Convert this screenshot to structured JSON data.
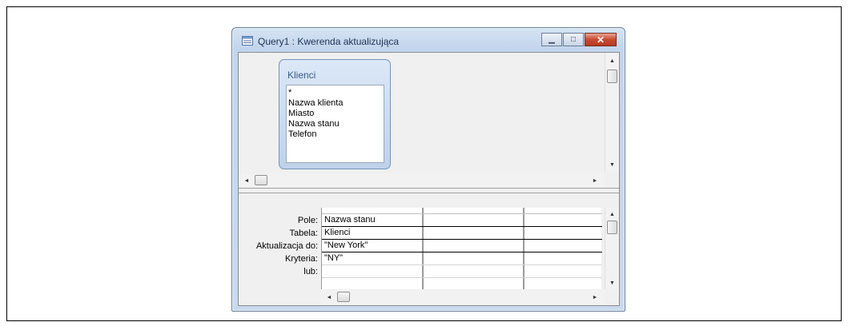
{
  "window": {
    "title": "Query1 : Kwerenda aktualizująca",
    "icon": "query-icon",
    "buttons": {
      "minimize": "▁",
      "maximize": "□",
      "close": "✕"
    }
  },
  "table": {
    "name": "Klienci",
    "fields": [
      "*",
      "Nazwa klienta",
      "Miasto",
      "Nazwa stanu",
      "Telefon"
    ]
  },
  "grid": {
    "row_labels": [
      "Pole:",
      "Tabela:",
      "Aktualizacja do:",
      "Kryteria:",
      "lub:"
    ],
    "columns": [
      {
        "pole": "Nazwa stanu",
        "tabela": "Klienci",
        "aktualizacja": "\"New York\"",
        "kryteria": "\"NY\"",
        "lub": ""
      },
      {
        "pole": "",
        "tabela": "",
        "aktualizacja": "",
        "kryteria": "",
        "lub": ""
      },
      {
        "pole": "",
        "tabela": "",
        "aktualizacja": "",
        "kryteria": "",
        "lub": ""
      }
    ]
  },
  "scroll_glyphs": {
    "up": "▲",
    "down": "▼",
    "left": "◄",
    "right": "►"
  },
  "colors": {
    "title_bar": "#c2d5ec",
    "close_button": "#c64a32",
    "table_box": "#bdd2ea"
  }
}
